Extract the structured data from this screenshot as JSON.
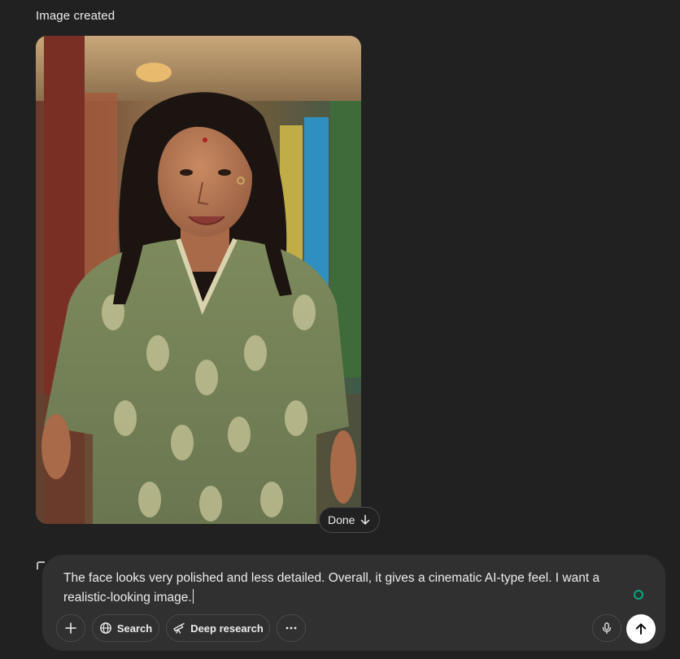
{
  "message": {
    "caption": "Image created",
    "image_alt": "Generated portrait of a smiling woman with long dark hair wearing a green printed kurta in a colorful corridor",
    "done_label": "Done"
  },
  "composer": {
    "text": "The face looks very polished and less detailed. Overall, it gives a cinematic AI-type feel. I want a realistic-looking image.",
    "tools": {
      "plus_icon": "plus-icon",
      "search_label": "Search",
      "search_icon": "globe-icon",
      "deep_research_label": "Deep research",
      "deep_research_icon": "telescope-icon",
      "more_icon": "more-horizontal-icon",
      "mic_icon": "microphone-icon",
      "send_icon": "arrow-up-icon"
    }
  },
  "colors": {
    "background": "#212121",
    "composer_bg": "#303030",
    "send_button": "#ffffff",
    "status_dot": "#10a37f"
  }
}
